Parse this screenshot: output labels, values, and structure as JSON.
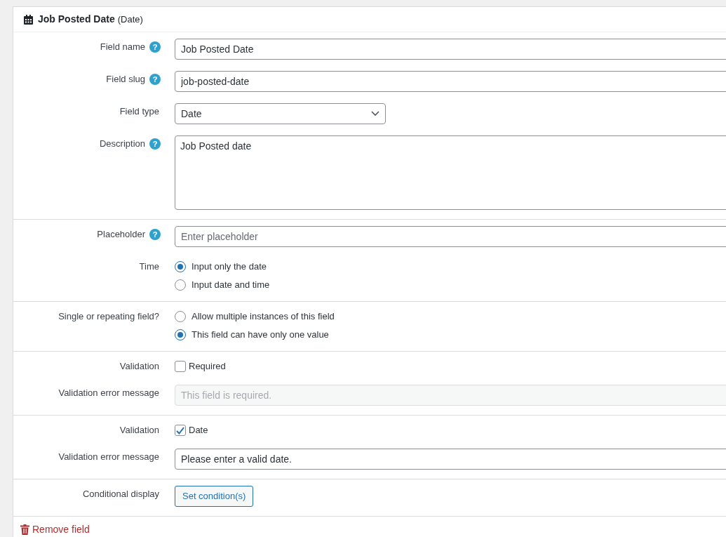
{
  "header": {
    "title": "Job Posted Date",
    "type": "(Date)"
  },
  "sections": [
    {
      "rows": [
        {
          "kind": "text",
          "label": "Field name",
          "help": "?",
          "value": "Job Posted Date"
        },
        {
          "kind": "text",
          "label": "Field slug",
          "help": "?",
          "value": "job-posted-date"
        },
        {
          "kind": "select",
          "label": "Field type",
          "value": "Date"
        },
        {
          "kind": "textarea",
          "label": "Description",
          "help": "?",
          "value": "Job Posted date"
        }
      ]
    },
    {
      "rows": [
        {
          "kind": "text",
          "label": "Placeholder",
          "help": "?",
          "placeholder": "Enter placeholder"
        },
        {
          "kind": "radios",
          "label": "Time",
          "options": [
            {
              "label": "Input only the date",
              "selected": true
            },
            {
              "label": "Input date and time",
              "selected": false
            }
          ]
        }
      ]
    },
    {
      "rows": [
        {
          "kind": "radios",
          "label": "Single or repeating field?",
          "options": [
            {
              "label": "Allow multiple instances of this field",
              "selected": false
            },
            {
              "label": "This field can have only one value",
              "selected": true
            }
          ]
        }
      ]
    },
    {
      "rows": [
        {
          "kind": "checkbox",
          "label": "Validation",
          "option": "Required",
          "checked": false
        },
        {
          "kind": "text",
          "label": "Validation error message",
          "placeholder": "This field is required.",
          "disabled": true
        }
      ]
    },
    {
      "rows": [
        {
          "kind": "checkbox",
          "label": "Validation",
          "option": "Date",
          "checked": true
        },
        {
          "kind": "text",
          "label": "Validation error message",
          "value": "Please enter a valid date.",
          "disabled": false
        }
      ]
    },
    {
      "rows": [
        {
          "kind": "button",
          "label": "Conditional display",
          "button": "Set condition(s)"
        }
      ]
    }
  ],
  "footer": {
    "remove": "Remove field"
  }
}
